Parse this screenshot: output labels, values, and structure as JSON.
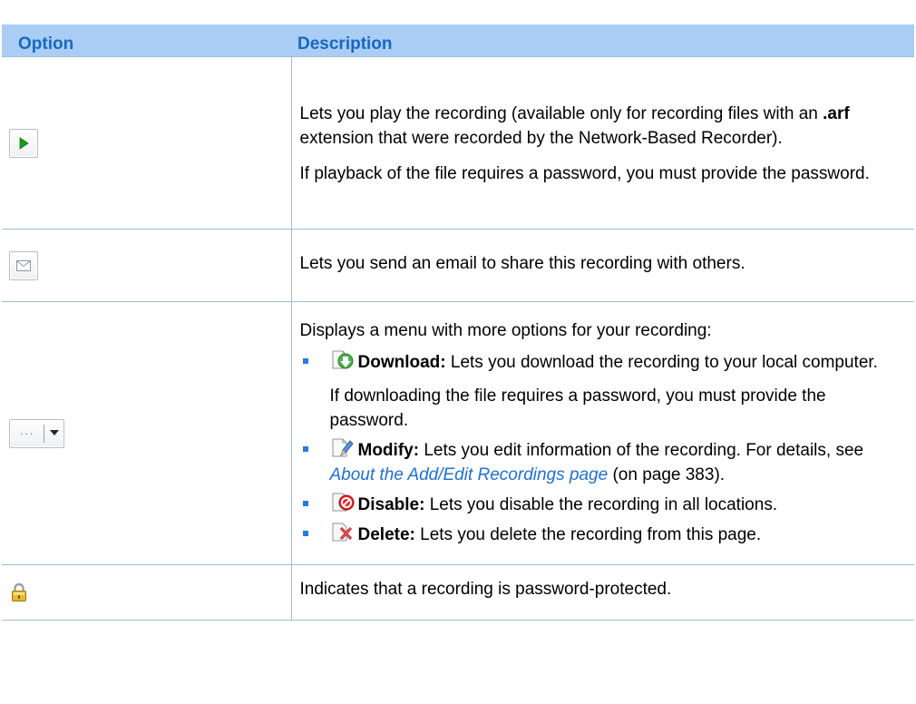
{
  "table": {
    "headers": {
      "option": "Option",
      "description": "Description"
    },
    "rows": {
      "play": {
        "icon": "play-icon",
        "p1_before": "Lets you play the recording (available only for recording files with an ",
        "p1_bold": ".arf",
        "p1_after": " extension that were recorded by the Network-Based Recorder).",
        "p2": "If playback of the file requires a password, you must provide the password."
      },
      "email": {
        "icon": "email-icon",
        "desc": "Lets you send an email to share this recording with others."
      },
      "more": {
        "icon": "more-options-icon",
        "dots": "···",
        "intro": "Displays a menu with more options for your recording:",
        "items": {
          "download": {
            "icon": "download-icon",
            "label": "Download:",
            "text": " Lets you download the recording to your local computer.",
            "note": "If downloading the file requires a password, you must provide the password."
          },
          "modify": {
            "icon": "modify-icon",
            "label": "Modify:",
            "text_before": " Lets you edit information of the recording. For details, see ",
            "link": "About the Add/Edit Recordings page",
            "text_after": " (on page 383)."
          },
          "disable": {
            "icon": "disable-icon",
            "label": "Disable:",
            "text": " Lets you disable the recording in all locations."
          },
          "delete": {
            "icon": "delete-icon",
            "label": "Delete:",
            "text": " Lets you delete the recording from this page."
          }
        }
      },
      "lock": {
        "icon": "lock-icon",
        "desc": "Indicates that a recording is password-protected."
      }
    }
  },
  "colors": {
    "header_bg": "#a9cdf4",
    "header_text": "#1767c2",
    "rule": "#9dbcd9",
    "link": "#1f6fd6",
    "bullet": "#1f7de0"
  }
}
